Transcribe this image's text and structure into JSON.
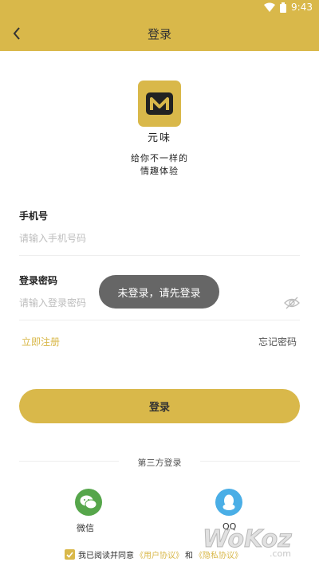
{
  "status_bar": {
    "time": "9:43"
  },
  "header": {
    "title": "登录"
  },
  "brand": {
    "name": "元味",
    "slogan_line1": "给你不一样的",
    "slogan_line2": "情趣体验"
  },
  "form": {
    "phone_label": "手机号",
    "phone_placeholder": "请输入手机号码",
    "phone_value": "",
    "password_label": "登录密码",
    "password_placeholder": "请输入登录密码",
    "password_value": ""
  },
  "links": {
    "register": "立即注册",
    "forgot": "忘记密码"
  },
  "login_button": "登录",
  "third_party": {
    "title": "第三方登录",
    "wechat": "微信",
    "qq": "QQ"
  },
  "agreement": {
    "checked": true,
    "prefix": "我已阅读并同意",
    "user_agreement": "《用户协议》",
    "conjunction": "和",
    "privacy_agreement": "《隐私协议》"
  },
  "toast": "未登录，请先登录",
  "watermark": "WoKoz.com",
  "colors": {
    "accent": "#d9b84a",
    "wechat": "#56a64b",
    "qq": "#4aaee6"
  }
}
